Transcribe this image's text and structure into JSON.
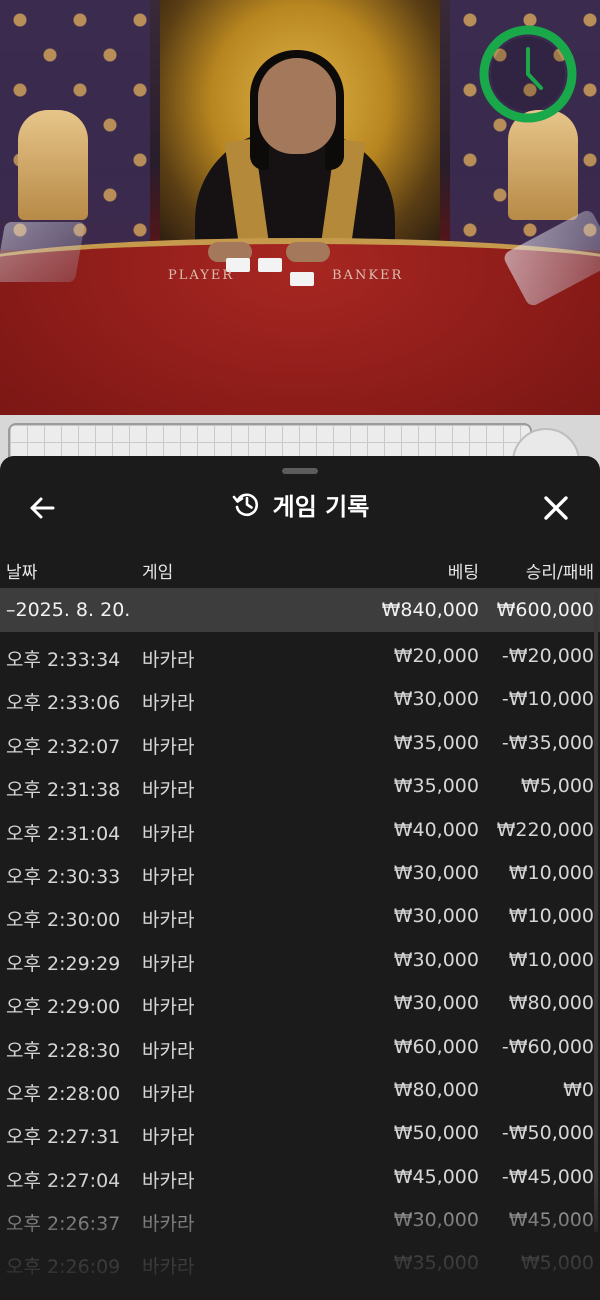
{
  "video": {
    "table_labels": [
      "PLAYER",
      "BANKER"
    ]
  },
  "colors": {
    "timer_ring": "#19a84a",
    "sheet_bg": "#1b1b1b",
    "date_row_bg": "#3d3d3d"
  },
  "icons": {
    "back": "arrow-left-icon",
    "history": "history-icon",
    "close": "close-icon",
    "timer": "clock-icon"
  },
  "sheet": {
    "title": "게임 기록",
    "columns": {
      "date": "날짜",
      "game": "게임",
      "bet": "베팅",
      "result": "승리/패배"
    },
    "date_group": {
      "label": "–2025. 8. 20.",
      "bet_total": "₩840,000",
      "result_total": "₩600,000"
    },
    "rows": [
      {
        "time": "오후 2:33:34",
        "game": "바카라",
        "bet": "₩20,000",
        "result": "-₩20,000"
      },
      {
        "time": "오후 2:33:06",
        "game": "바카라",
        "bet": "₩30,000",
        "result": "-₩10,000"
      },
      {
        "time": "오후 2:32:07",
        "game": "바카라",
        "bet": "₩35,000",
        "result": "-₩35,000"
      },
      {
        "time": "오후 2:31:38",
        "game": "바카라",
        "bet": "₩35,000",
        "result": "₩5,000"
      },
      {
        "time": "오후 2:31:04",
        "game": "바카라",
        "bet": "₩40,000",
        "result": "₩220,000"
      },
      {
        "time": "오후 2:30:33",
        "game": "바카라",
        "bet": "₩30,000",
        "result": "₩10,000"
      },
      {
        "time": "오후 2:30:00",
        "game": "바카라",
        "bet": "₩30,000",
        "result": "₩10,000"
      },
      {
        "time": "오후 2:29:29",
        "game": "바카라",
        "bet": "₩30,000",
        "result": "₩10,000"
      },
      {
        "time": "오후 2:29:00",
        "game": "바카라",
        "bet": "₩30,000",
        "result": "₩80,000"
      },
      {
        "time": "오후 2:28:30",
        "game": "바카라",
        "bet": "₩60,000",
        "result": "-₩60,000"
      },
      {
        "time": "오후 2:28:00",
        "game": "바카라",
        "bet": "₩80,000",
        "result": "₩0"
      },
      {
        "time": "오후 2:27:31",
        "game": "바카라",
        "bet": "₩50,000",
        "result": "-₩50,000"
      },
      {
        "time": "오후 2:27:04",
        "game": "바카라",
        "bet": "₩45,000",
        "result": "-₩45,000"
      },
      {
        "time": "오후 2:26:37",
        "game": "바카라",
        "bet": "₩30,000",
        "result": "₩45,000"
      },
      {
        "time": "오후 2:26:09",
        "game": "바카라",
        "bet": "₩35,000",
        "result": "₩5,000"
      }
    ]
  }
}
